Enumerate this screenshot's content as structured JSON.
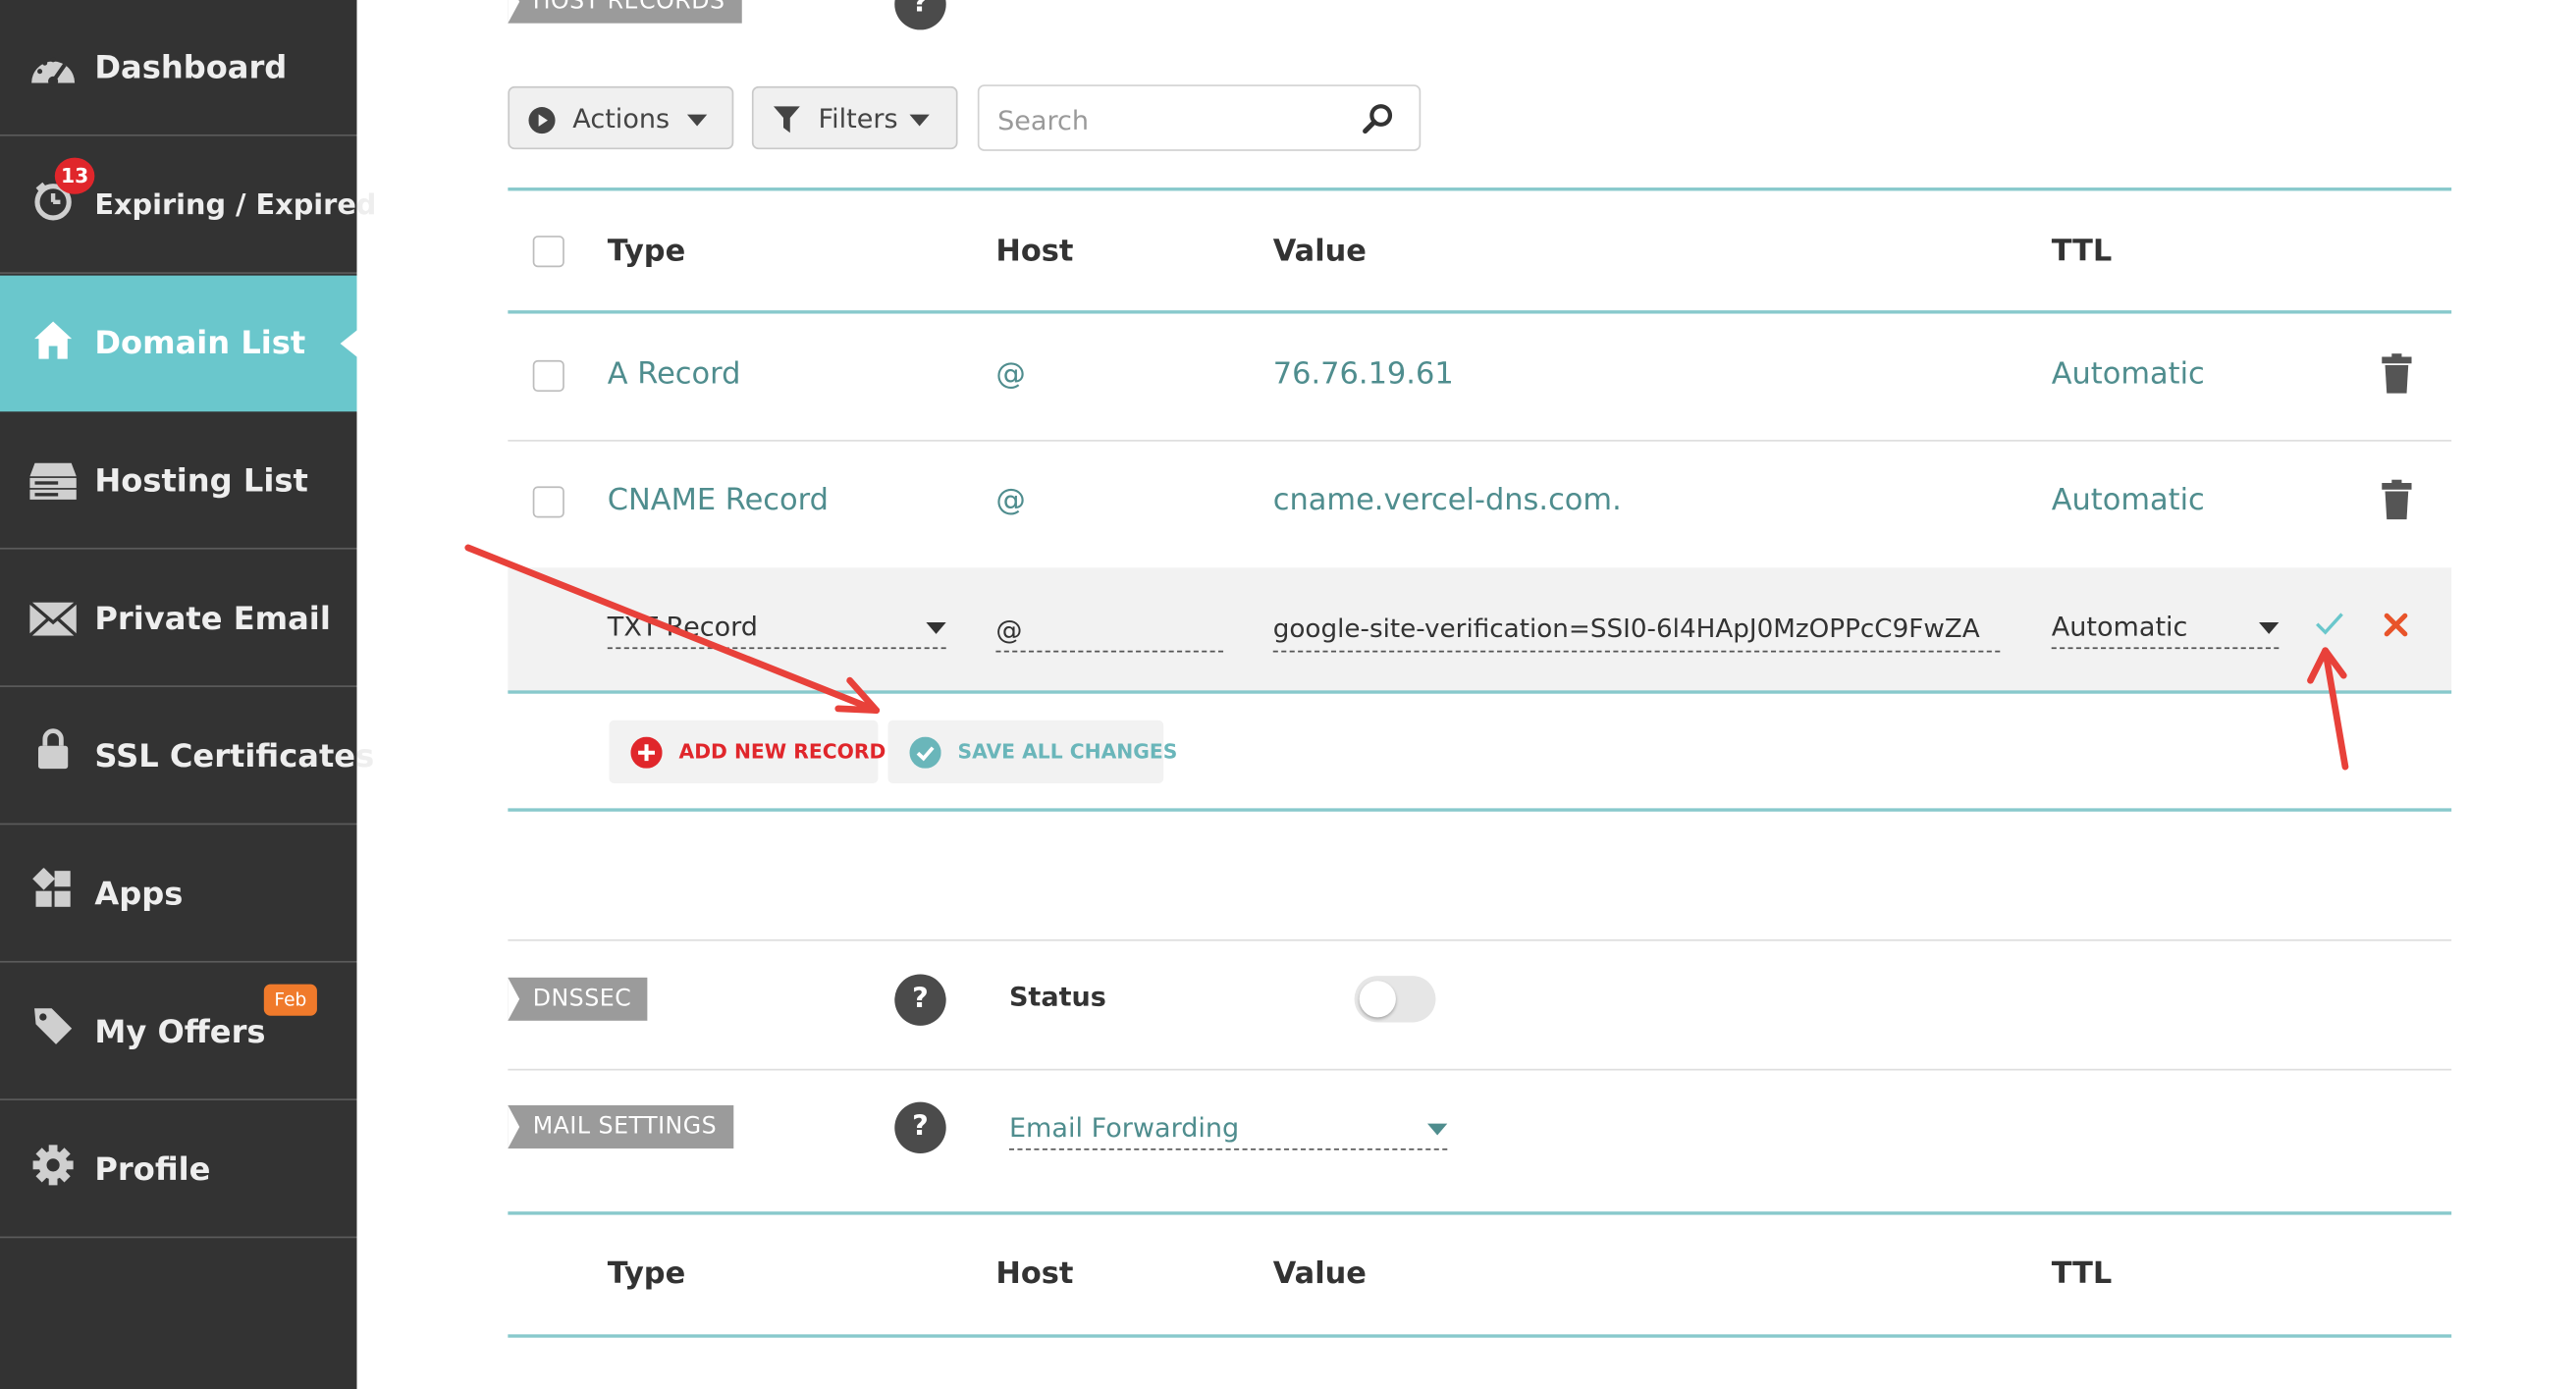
{
  "sidebar": {
    "items": [
      {
        "label": "Dashboard",
        "icon": "speedometer-icon"
      },
      {
        "label": "Expiring / Expired",
        "icon": "stopwatch-icon",
        "badge": "13"
      },
      {
        "label": "Domain List",
        "icon": "home-icon",
        "active": true
      },
      {
        "label": "Hosting List",
        "icon": "server-icon"
      },
      {
        "label": "Private Email",
        "icon": "envelope-icon"
      },
      {
        "label": "SSL Certificates",
        "icon": "lock-icon"
      },
      {
        "label": "Apps",
        "icon": "apps-grid-icon"
      },
      {
        "label": "My Offers",
        "icon": "tag-icon",
        "badge": "Feb"
      },
      {
        "label": "Profile",
        "icon": "gear-icon"
      }
    ]
  },
  "host_records": {
    "tag": "HOST RECORDS",
    "help": "?",
    "actions_label": "Actions",
    "filters_label": "Filters",
    "search_placeholder": "Search",
    "columns": {
      "type": "Type",
      "host": "Host",
      "value": "Value",
      "ttl": "TTL"
    },
    "rows": [
      {
        "type": "A Record",
        "host": "@",
        "value": "76.76.19.61",
        "ttl": "Automatic"
      },
      {
        "type": "CNAME Record",
        "host": "@",
        "value": "cname.vercel-dns.com.",
        "ttl": "Automatic"
      }
    ],
    "edit_row": {
      "type": "TXT Record",
      "host": "@",
      "value": "google-site-verification=SSI0-6l4HApJ0MzOPPcC9FwZA",
      "ttl": "Automatic"
    },
    "add_new_record": "ADD NEW RECORD",
    "save_all_changes": "SAVE ALL CHANGES"
  },
  "dnssec": {
    "tag": "DNSSEC",
    "help": "?",
    "status_label": "Status",
    "enabled": false
  },
  "mail_settings": {
    "tag": "MAIL SETTINGS",
    "help": "?",
    "selected": "Email Forwarding",
    "columns": {
      "type": "Type",
      "host": "Host",
      "value": "Value",
      "ttl": "TTL"
    }
  },
  "colors": {
    "sidebar_bg": "#333333",
    "active_nav": "#6ac7cc",
    "teal_text": "#4f8d8e",
    "annotation_arrow": "#e8413a",
    "delete_x": "#e8542a"
  }
}
